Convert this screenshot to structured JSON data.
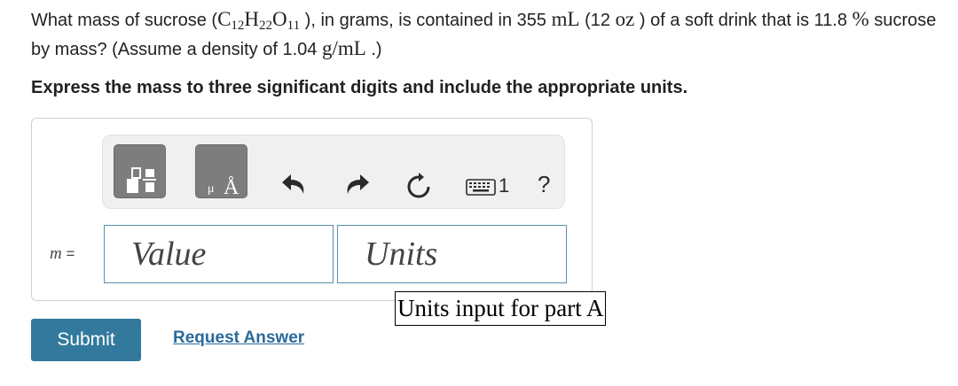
{
  "question": {
    "t1": "What mass of sucrose (",
    "formula_c": "C",
    "formula_c_sub": "12",
    "formula_h": "H",
    "formula_h_sub": "22",
    "formula_o": "O",
    "formula_o_sub": "11",
    "t2": "), in grams, is contained in 355",
    "unit_ml": "mL",
    "t3": "(12",
    "unit_oz": "oz",
    "t4": ") of a soft drink that is 11.8",
    "percent": "%",
    "t5": "sucrose by mass? (Assume a density of 1.04",
    "unit_density": "g/mL",
    "t6": ".)"
  },
  "instruction": "Express the mass to three significant digits and include the appropriate units.",
  "toolbar": {
    "units_glyph": "Å",
    "units_small": "μ",
    "help_label": "?",
    "keyboard_shortcut_hint": "1"
  },
  "answer": {
    "variable": "m",
    "equals": "=",
    "value_placeholder": "Value",
    "units_placeholder": "Units",
    "units_tooltip": "Units input for part A"
  },
  "buttons": {
    "submit": "Submit",
    "request_answer": "Request Answer"
  },
  "colors": {
    "submit_bg": "#33799d",
    "link": "#2b6a9a",
    "input_border": "#5b8fa8",
    "toolbar_button": "#7d7d7d"
  }
}
